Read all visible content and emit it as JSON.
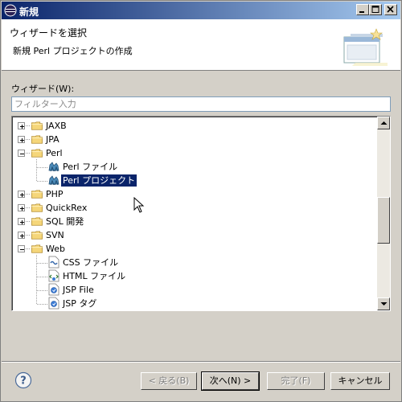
{
  "window": {
    "title": "新規"
  },
  "header": {
    "title": "ウィザードを選択",
    "description": "新規 Perl プロジェクトの作成"
  },
  "wizards": {
    "label": "ウィザード(W):",
    "filter_placeholder": "フィルター入力",
    "items": [
      {
        "label": "JAXB",
        "type": "folder",
        "expand": "plus"
      },
      {
        "label": "JPA",
        "type": "folder",
        "expand": "plus"
      },
      {
        "label": "Perl",
        "type": "folder",
        "expand": "minus"
      },
      {
        "label": "Perl ファイル",
        "type": "perl"
      },
      {
        "label": "Perl プロジェクト",
        "type": "perl",
        "selected": true
      },
      {
        "label": "PHP",
        "type": "folder",
        "expand": "plus"
      },
      {
        "label": "QuickRex",
        "type": "folder",
        "expand": "plus"
      },
      {
        "label": "SQL 開発",
        "type": "folder",
        "expand": "plus"
      },
      {
        "label": "SVN",
        "type": "folder",
        "expand": "plus"
      },
      {
        "label": "Web",
        "type": "folder",
        "expand": "minus"
      },
      {
        "label": "CSS ファイル",
        "type": "css"
      },
      {
        "label": "HTML ファイル",
        "type": "html"
      },
      {
        "label": "JSP File",
        "type": "jsp"
      },
      {
        "label": "JSP タグ",
        "type": "jsp"
      }
    ]
  },
  "footer": {
    "back": "< 戻る(B)",
    "next": "次へ(N) >",
    "finish": "完了(F)",
    "cancel": "キャンセル"
  },
  "colors": {
    "selection": "#0a246a",
    "titlebar_start": "#0a246a",
    "titlebar_end": "#a6caf0",
    "face": "#d4d0c8"
  }
}
